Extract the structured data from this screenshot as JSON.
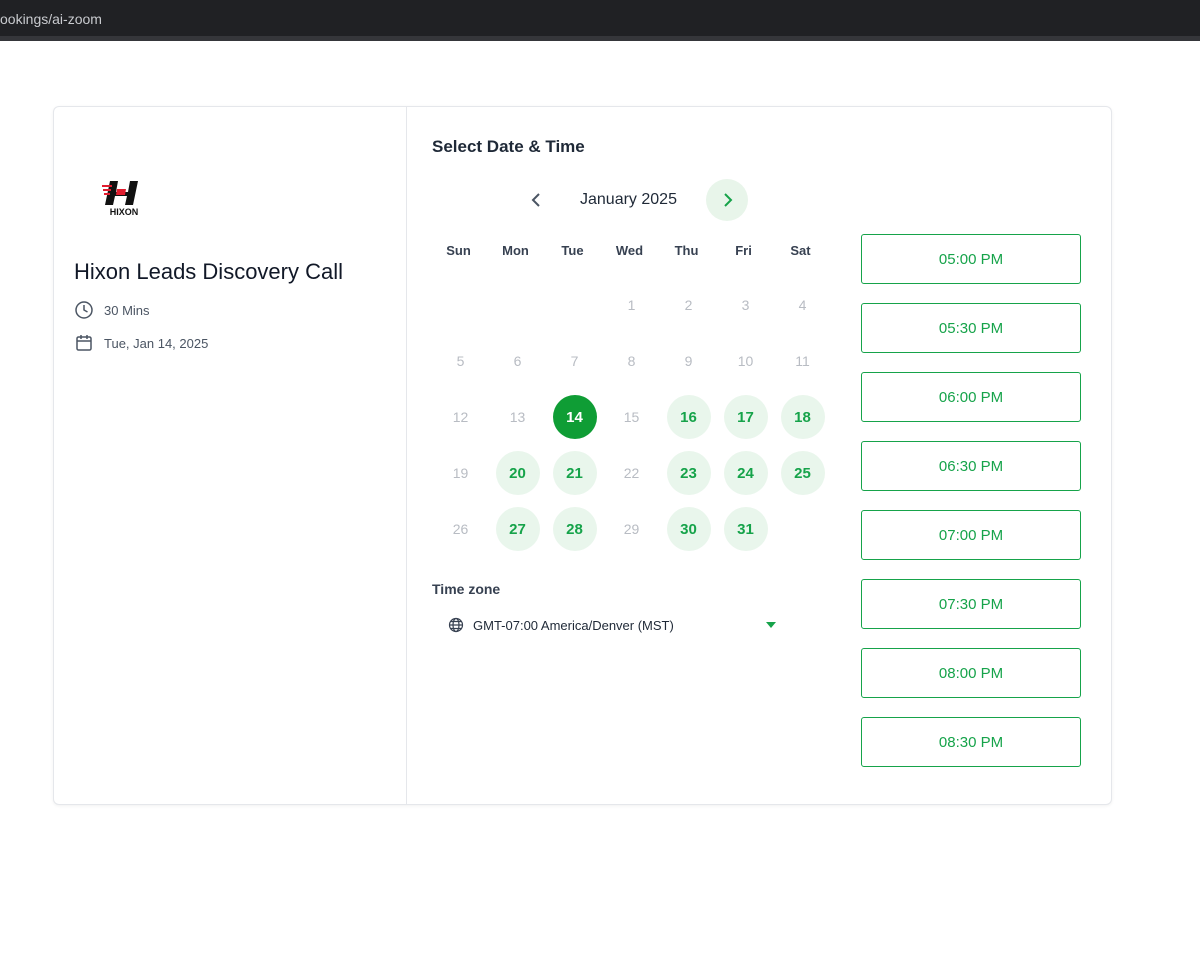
{
  "browser": {
    "url": "ookings/ai-zoom"
  },
  "brand": {
    "logo_text": "HIXON",
    "accent": "#16a34a",
    "selected": "#0f9d35"
  },
  "event": {
    "title": "Hixon Leads Discovery Call",
    "duration": "30 Mins",
    "date": "Tue, Jan 14, 2025",
    "duration_icon": "clock-icon",
    "date_icon": "calendar-icon"
  },
  "calendar": {
    "section_title": "Select Date & Time",
    "month": "January 2025",
    "weekdays": [
      "Sun",
      "Mon",
      "Tue",
      "Wed",
      "Thu",
      "Fri",
      "Sat"
    ],
    "first_weekday_index": 3,
    "days": [
      {
        "d": "1",
        "s": "disabled"
      },
      {
        "d": "2",
        "s": "disabled"
      },
      {
        "d": "3",
        "s": "disabled"
      },
      {
        "d": "4",
        "s": "disabled"
      },
      {
        "d": "5",
        "s": "disabled"
      },
      {
        "d": "6",
        "s": "disabled"
      },
      {
        "d": "7",
        "s": "disabled"
      },
      {
        "d": "8",
        "s": "disabled"
      },
      {
        "d": "9",
        "s": "disabled"
      },
      {
        "d": "10",
        "s": "disabled"
      },
      {
        "d": "11",
        "s": "disabled"
      },
      {
        "d": "12",
        "s": "disabled"
      },
      {
        "d": "13",
        "s": "disabled"
      },
      {
        "d": "14",
        "s": "selected"
      },
      {
        "d": "15",
        "s": "disabled"
      },
      {
        "d": "16",
        "s": "available"
      },
      {
        "d": "17",
        "s": "available"
      },
      {
        "d": "18",
        "s": "available"
      },
      {
        "d": "19",
        "s": "disabled"
      },
      {
        "d": "20",
        "s": "available"
      },
      {
        "d": "21",
        "s": "available"
      },
      {
        "d": "22",
        "s": "disabled"
      },
      {
        "d": "23",
        "s": "available"
      },
      {
        "d": "24",
        "s": "available"
      },
      {
        "d": "25",
        "s": "available"
      },
      {
        "d": "26",
        "s": "disabled"
      },
      {
        "d": "27",
        "s": "available"
      },
      {
        "d": "28",
        "s": "available"
      },
      {
        "d": "29",
        "s": "disabled"
      },
      {
        "d": "30",
        "s": "available"
      },
      {
        "d": "31",
        "s": "available"
      }
    ]
  },
  "timezone": {
    "label": "Time zone",
    "value": "GMT-07:00 America/Denver (MST)"
  },
  "slots": [
    "05:00 PM",
    "05:30 PM",
    "06:00 PM",
    "06:30 PM",
    "07:00 PM",
    "07:30 PM",
    "08:00 PM",
    "08:30 PM"
  ]
}
